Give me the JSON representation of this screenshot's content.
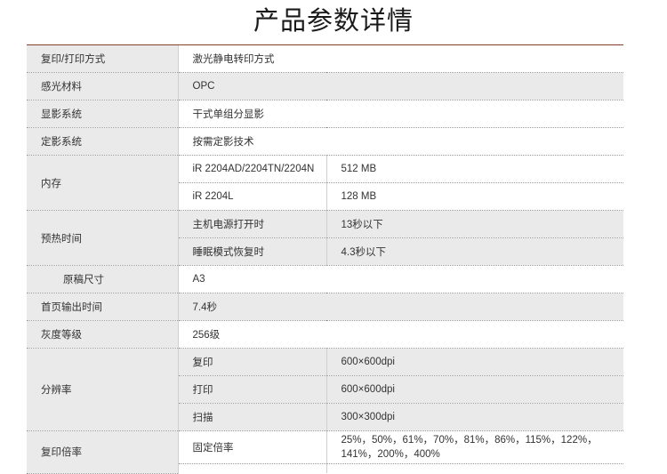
{
  "page": {
    "title": "产品参数详情"
  },
  "specs": {
    "copy_method": {
      "label": "复印/打印方式",
      "value": "激光静电转印方式"
    },
    "photoconductor": {
      "label": "感光材料",
      "value": "OPC"
    },
    "developing": {
      "label": "显影系统",
      "value": "干式单组分显影"
    },
    "fixing": {
      "label": "定影系统",
      "value": "按需定影技术"
    },
    "memory": {
      "label": "内存",
      "rows": [
        {
          "model": "iR 2204AD/2204TN/2204N",
          "value": "512 MB"
        },
        {
          "model": "iR 2204L",
          "value": "128 MB"
        }
      ]
    },
    "warmup": {
      "label": "预热时间",
      "rows": [
        {
          "condition": "主机电源打开时",
          "value": "13秒以下"
        },
        {
          "condition": "睡眠模式恢复时",
          "value": "4.3秒以下"
        }
      ]
    },
    "original_size": {
      "label": "原稿尺寸",
      "value": "A3"
    },
    "first_copy": {
      "label": "首页输出时间",
      "value": "7.4秒"
    },
    "grayscale": {
      "label": "灰度等级",
      "value": "256级"
    },
    "resolution": {
      "label": "分辨率",
      "rows": [
        {
          "mode": "复印",
          "value": "600×600dpi"
        },
        {
          "mode": "打印",
          "value": "600×600dpi"
        },
        {
          "mode": "扫描",
          "value": "300×300dpi"
        }
      ]
    },
    "zoom": {
      "label": "复印倍率",
      "rows": [
        {
          "mode": "固定倍率",
          "value": "25%，50%，61%，70%，81%，86%，115%，122%，141%，200%，400%"
        }
      ]
    }
  }
}
